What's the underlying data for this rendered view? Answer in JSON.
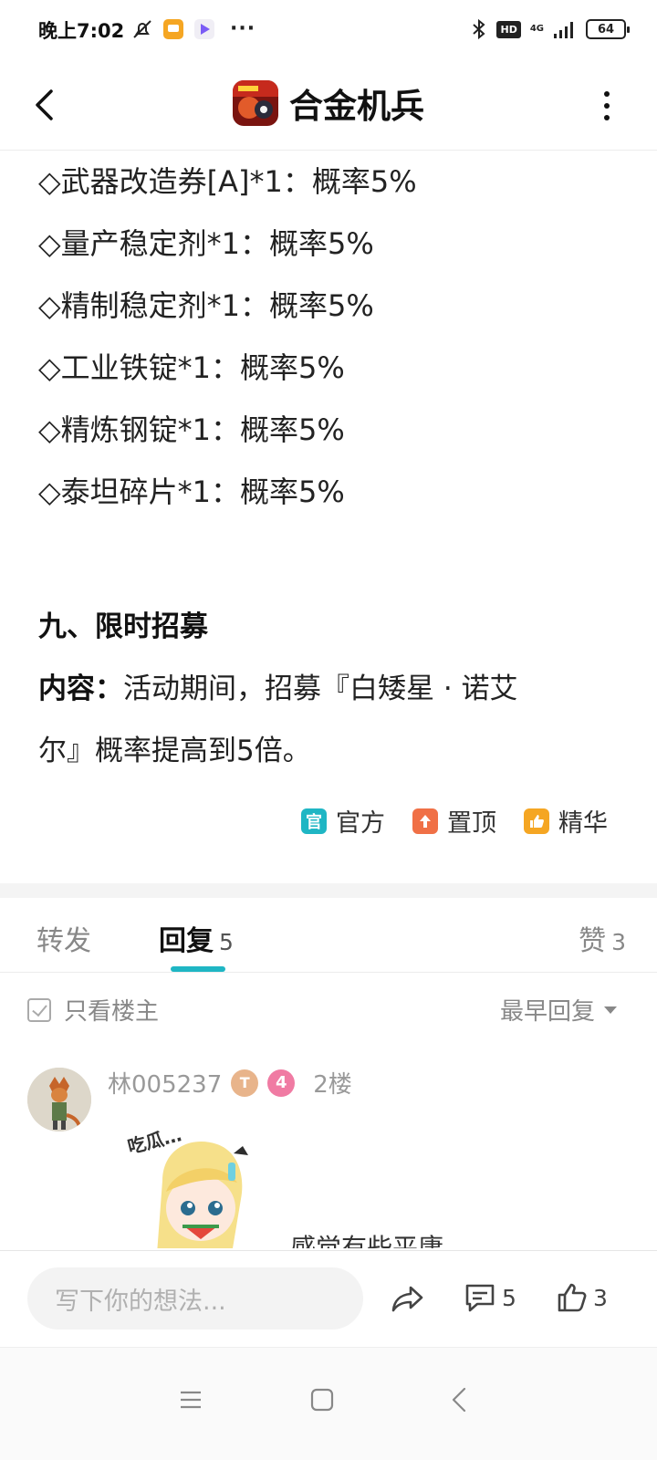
{
  "status_bar": {
    "time": "晚上7:02",
    "hd": "HD",
    "network": "4G",
    "battery": "64"
  },
  "header": {
    "title": "合金机兵"
  },
  "article": {
    "prob_lines": [
      "◇武器改造券[A]*1：概率5%",
      "◇量产稳定剂*1：概率5%",
      "◇精制稳定剂*1：概率5%",
      "◇工业铁锭*1：概率5%",
      "◇精炼钢锭*1：概率5%",
      "◇泰坦碎片*1：概率5%"
    ],
    "section_title": "九、限时招募",
    "content_label": "内容：",
    "content_text_1": "活动期间，招募『白矮星 · 诺艾",
    "content_text_2": "尔』概率提高到5倍。",
    "tags": [
      {
        "icon_text": "官",
        "label": "官方",
        "color": "#1fb6c4"
      },
      {
        "icon_text": "⬆",
        "label": "置顶",
        "color": "#f07046"
      },
      {
        "icon_text": "👍",
        "label": "精华",
        "color": "#f5a623"
      }
    ]
  },
  "tabs": {
    "forward": "转发",
    "reply": "回复",
    "reply_count": "5",
    "like": "赞",
    "like_count": "3"
  },
  "filter": {
    "owner_only": "只看楼主",
    "sort": "最早回复"
  },
  "reply": {
    "username": "林005237",
    "badge_t": "T",
    "level": "4",
    "floor": "2楼",
    "text": "感觉有些平庸"
  },
  "comment_bar": {
    "placeholder": "写下你的想法...",
    "comment_count": "5",
    "like_count": "3"
  },
  "colors": {
    "accent": "#1fb6c4",
    "top_tag": "#f07046",
    "best_tag": "#f5a623"
  }
}
